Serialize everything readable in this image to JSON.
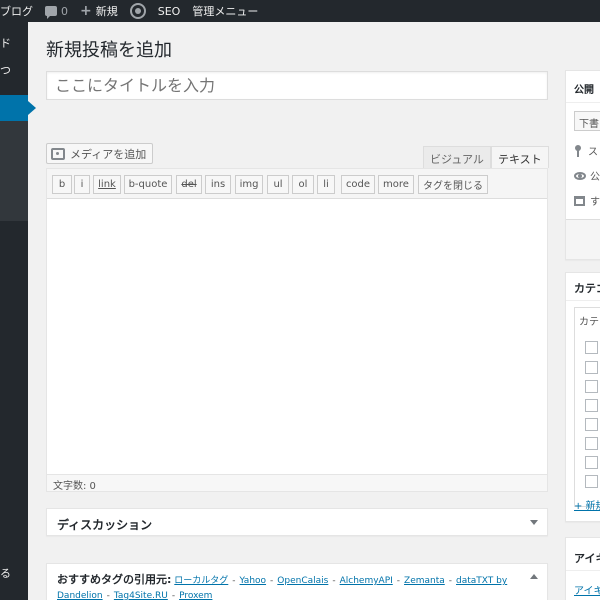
{
  "adminbar": {
    "site_name": "ブログ",
    "comments_count": "0",
    "new_label": "新規",
    "seo_label": "SEO",
    "manage_menu_label": "管理メニュー"
  },
  "sidebar": {
    "item1_fragment": "ド",
    "item2_fragment": "つ",
    "bottom_fragment": "る"
  },
  "main": {
    "page_title": "新規投稿を追加",
    "title_placeholder": "ここにタイトルを入力",
    "add_media_label": "メディアを追加",
    "tab_visual": "ビジュアル",
    "tab_text": "テキスト",
    "quicktags": [
      "b",
      "i",
      "link",
      "b-quote",
      "del",
      "ins",
      "img",
      "ul",
      "ol",
      "li",
      "code",
      "more",
      "タグを閉じる"
    ],
    "word_count": "文字数: 0",
    "discussion_title": "ディスカッション",
    "tag_title": "おすすめタグの引用元:",
    "tag_sources": [
      "ローカルタグ",
      "Yahoo",
      "OpenCalais",
      "AlchemyAPI",
      "Zemanta",
      "dataTXT by Dandelion",
      "Tag4Site.RU",
      "Proxem"
    ]
  },
  "publish": {
    "title": "公開",
    "draft_button": "下書",
    "status_fragment": "ス",
    "visibility_fragment": "公",
    "schedule_fragment": "す"
  },
  "category": {
    "title": "カテゴ",
    "tab_label": "カテ",
    "checkbox_count": 8,
    "add_new": "+ 新規"
  },
  "eyecatch": {
    "title": "アイキ",
    "link": "アイキャ"
  },
  "colors": {
    "adminbar_bg": "#23282d",
    "accent": "#0073aa",
    "page_bg": "#f1f1f1"
  }
}
